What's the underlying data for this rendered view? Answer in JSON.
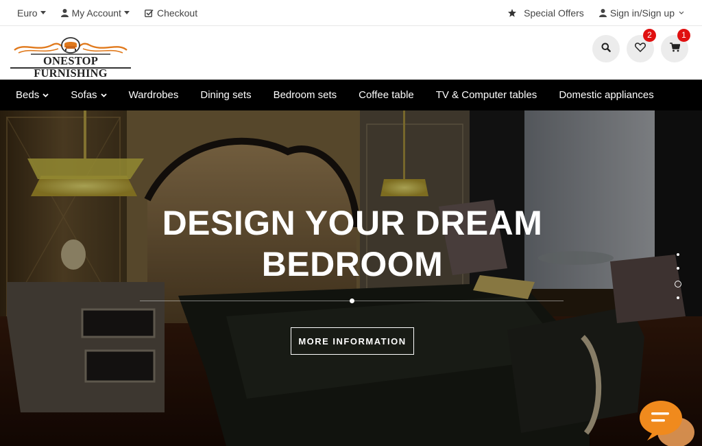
{
  "topbar": {
    "currency": "Euro",
    "account": "My Account",
    "checkout": "Checkout",
    "special_offers": "Special Offers",
    "sign_in": "Sign in/Sign up"
  },
  "logo": {
    "text": "ONESTOP FURNISHING"
  },
  "header": {
    "search_icon": "search-icon",
    "wishlist_count": "2",
    "cart_count": "1"
  },
  "nav": {
    "items": [
      {
        "label": "Beds",
        "dropdown": true
      },
      {
        "label": "Sofas",
        "dropdown": true
      },
      {
        "label": "Wardrobes"
      },
      {
        "label": "Dining sets"
      },
      {
        "label": "Bedroom sets"
      },
      {
        "label": "Coffee table"
      },
      {
        "label": "TV & Computer tables"
      },
      {
        "label": "Domestic appliances"
      }
    ]
  },
  "hero": {
    "title_line1": "DESIGN YOUR DREAM",
    "title_line2": "BEDROOM",
    "button": "MORE INFORMATION",
    "slides_total": 4,
    "active_slide": 3
  },
  "colors": {
    "nav_bg": "#000000",
    "badge": "#e01010",
    "chat_orange": "#f08a1d"
  }
}
